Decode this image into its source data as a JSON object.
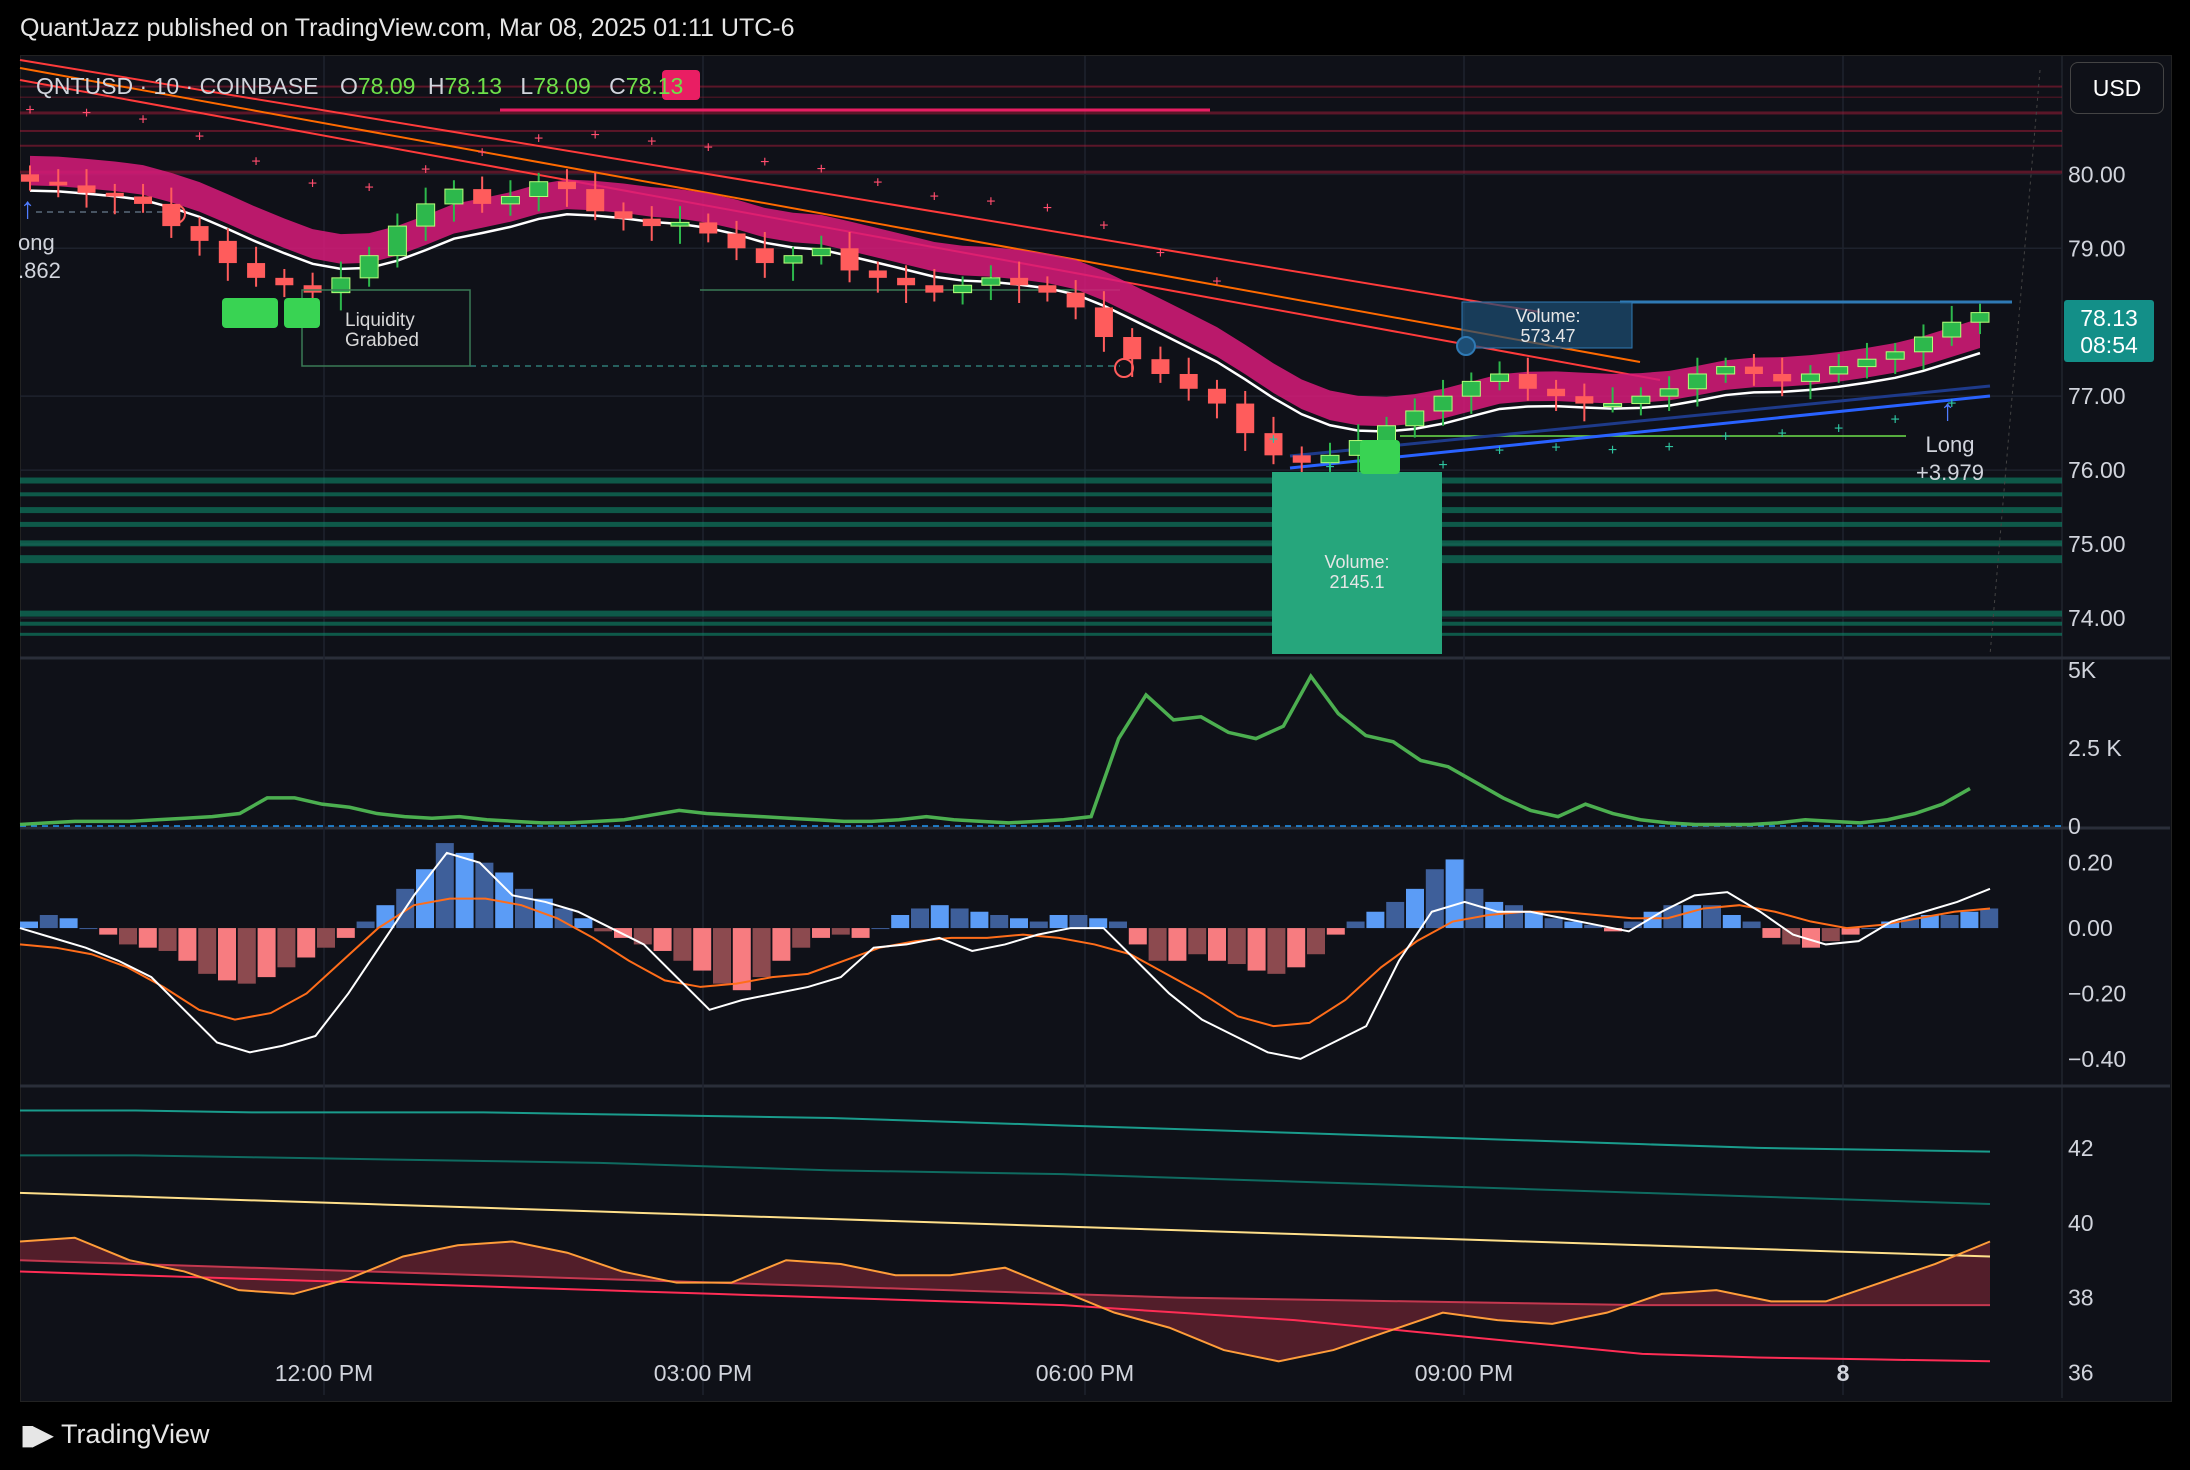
{
  "header": {
    "text": "QuantJazz published on TradingView.com, Mar 08, 2025 01:11 UTC-6"
  },
  "legend": {
    "symbol": "QNTUSD · 10 · COINBASE",
    "open_label": "O",
    "open": "78.09",
    "high_label": "H",
    "high": "78.13",
    "low_label": "L",
    "low": "78.09",
    "close_label": "C",
    "close": "78.13"
  },
  "currency_button": "USD",
  "price_tag": {
    "price": "78.13",
    "countdown": "08:54"
  },
  "annotations": {
    "long_left_label": "ong",
    "long_left_value": ".862",
    "liquidity_line1": "Liquidity",
    "liquidity_line2": "Grabbed",
    "volume_top_title": "Volume:",
    "volume_top_value": "573.47",
    "volume_bottom_title": "Volume:",
    "volume_bottom_value": "2145.1",
    "long_right_label": "Long",
    "long_right_value": "+3.979"
  },
  "footer": {
    "brand": "TradingView"
  },
  "colors": {
    "up": "#2db84c",
    "down": "#ff5c5c",
    "ema_band": "#d81b7a",
    "channel_red": "#ff3b3b",
    "channel_blue": "#2962ff",
    "volume_green": "#26a69a",
    "macd_pos": "#5b9cf6",
    "macd_neg": "#f77c80",
    "rsi_orange": "#ff9800",
    "indicator_green": "#4caf50"
  },
  "chart_data": [
    {
      "type": "candlestick",
      "pane": "price",
      "x_ticks": [
        "12:00 PM",
        "03:00 PM",
        "06:00 PM",
        "09:00 PM",
        "8"
      ],
      "y_ticks": [
        "80.00",
        "79.00",
        "77.00",
        "76.00",
        "75.00",
        "74.00"
      ],
      "ylim": [
        73.5,
        81.6
      ],
      "close_series": [
        79.9,
        79.85,
        79.75,
        79.7,
        79.6,
        79.3,
        79.1,
        78.8,
        78.6,
        78.5,
        78.4,
        78.6,
        78.9,
        79.3,
        79.6,
        79.8,
        79.6,
        79.7,
        79.9,
        79.8,
        79.5,
        79.4,
        79.3,
        79.35,
        79.2,
        79.0,
        78.8,
        78.9,
        79.0,
        78.7,
        78.6,
        78.5,
        78.4,
        78.5,
        78.6,
        78.5,
        78.4,
        78.2,
        77.8,
        77.5,
        77.3,
        77.1,
        76.9,
        76.5,
        76.2,
        76.1,
        76.2,
        76.4,
        76.6,
        76.8,
        77.0,
        77.2,
        77.3,
        77.1,
        77.0,
        76.9,
        76.9,
        77.0,
        77.1,
        77.3,
        77.4,
        77.3,
        77.2,
        77.3,
        77.4,
        77.5,
        77.6,
        77.8,
        78.0,
        78.13
      ]
    },
    {
      "type": "line",
      "pane": "volume_indicator",
      "y_ticks": [
        "5K",
        "2.5 K",
        "0"
      ],
      "ylim": [
        0,
        5000
      ],
      "values": [
        50,
        100,
        150,
        150,
        150,
        200,
        250,
        300,
        400,
        900,
        900,
        700,
        600,
        400,
        300,
        250,
        300,
        200,
        150,
        100,
        100,
        150,
        200,
        350,
        500,
        400,
        350,
        300,
        250,
        200,
        150,
        150,
        200,
        300,
        200,
        150,
        100,
        150,
        200,
        300,
        2800,
        4200,
        3400,
        3500,
        3000,
        2800,
        3200,
        4800,
        3600,
        2900,
        2700,
        2100,
        1900,
        1400,
        900,
        500,
        300,
        700,
        400,
        200,
        100,
        50,
        50,
        50,
        100,
        200,
        150,
        100,
        200,
        400,
        700,
        1200
      ]
    },
    {
      "type": "bar+line",
      "pane": "macd",
      "y_ticks": [
        "0.20",
        "0.00",
        "−0.20",
        "−0.40"
      ],
      "ylim": [
        -0.48,
        0.3
      ],
      "histogram": [
        0.02,
        0.04,
        0.03,
        0.0,
        -0.02,
        -0.05,
        -0.06,
        -0.07,
        -0.1,
        -0.14,
        -0.16,
        -0.17,
        -0.15,
        -0.12,
        -0.09,
        -0.06,
        -0.03,
        0.02,
        0.07,
        0.12,
        0.18,
        0.26,
        0.23,
        0.2,
        0.17,
        0.12,
        0.09,
        0.06,
        0.03,
        -0.01,
        -0.03,
        -0.05,
        -0.07,
        -0.1,
        -0.13,
        -0.17,
        -0.19,
        -0.15,
        -0.1,
        -0.06,
        -0.03,
        -0.02,
        -0.03,
        0.0,
        0.04,
        0.06,
        0.07,
        0.06,
        0.05,
        0.04,
        0.03,
        0.02,
        0.04,
        0.04,
        0.03,
        0.02,
        -0.05,
        -0.1,
        -0.1,
        -0.08,
        -0.1,
        -0.11,
        -0.13,
        -0.14,
        -0.12,
        -0.08,
        -0.02,
        0.02,
        0.05,
        0.08,
        0.12,
        0.18,
        0.21,
        0.12,
        0.08,
        0.07,
        0.05,
        0.03,
        0.02,
        0.01,
        -0.01,
        0.02,
        0.05,
        0.07,
        0.07,
        0.07,
        0.04,
        0.02,
        -0.03,
        -0.05,
        -0.06,
        -0.04,
        -0.02,
        0.0,
        0.02,
        0.03,
        0.04,
        0.04,
        0.05,
        0.06
      ],
      "macd_line": [
        0.0,
        -0.03,
        -0.06,
        -0.1,
        -0.15,
        -0.25,
        -0.35,
        -0.38,
        -0.36,
        -0.33,
        -0.2,
        -0.05,
        0.1,
        0.23,
        0.2,
        0.1,
        0.08,
        0.05,
        0.0,
        -0.05,
        -0.15,
        -0.25,
        -0.22,
        -0.2,
        -0.18,
        -0.15,
        -0.06,
        -0.05,
        -0.03,
        -0.07,
        -0.05,
        -0.02,
        0.0,
        0.0,
        -0.1,
        -0.2,
        -0.28,
        -0.33,
        -0.38,
        -0.4,
        -0.35,
        -0.3,
        -0.1,
        0.05,
        0.08,
        0.05,
        0.05,
        0.03,
        0.01,
        -0.01,
        0.05,
        0.1,
        0.11,
        0.05,
        -0.02,
        -0.05,
        -0.04,
        0.02,
        0.05,
        0.08,
        0.12
      ],
      "signal_line": [
        -0.05,
        -0.06,
        -0.08,
        -0.12,
        -0.18,
        -0.25,
        -0.28,
        -0.26,
        -0.2,
        -0.1,
        0.0,
        0.07,
        0.09,
        0.09,
        0.07,
        0.03,
        -0.03,
        -0.1,
        -0.16,
        -0.18,
        -0.17,
        -0.15,
        -0.14,
        -0.1,
        -0.06,
        -0.04,
        -0.03,
        -0.03,
        -0.02,
        -0.03,
        -0.05,
        -0.08,
        -0.14,
        -0.2,
        -0.27,
        -0.3,
        -0.29,
        -0.22,
        -0.12,
        -0.04,
        0.02,
        0.04,
        0.05,
        0.05,
        0.04,
        0.03,
        0.03,
        0.06,
        0.07,
        0.05,
        0.02,
        0.0,
        0.01,
        0.03,
        0.05,
        0.06
      ]
    },
    {
      "type": "line",
      "pane": "oscillator",
      "y_ticks": [
        "42",
        "40",
        "38",
        "36"
      ],
      "ylim": [
        35.4,
        43.6
      ],
      "series": [
        {
          "values": [
            43.0,
            43.0,
            42.95,
            42.95,
            42.95,
            42.9,
            42.85,
            42.8,
            42.7,
            42.6,
            42.5,
            42.4,
            42.3,
            42.2,
            42.1,
            42.0,
            41.95,
            41.9
          ]
        },
        {
          "values": [
            41.8,
            41.8,
            41.75,
            41.7,
            41.65,
            41.6,
            41.5,
            41.4,
            41.35,
            41.3,
            41.2,
            41.1,
            41.0,
            40.9,
            40.8,
            40.7,
            40.6,
            40.5
          ]
        },
        {
          "values": [
            40.8,
            40.7,
            40.6,
            40.5,
            40.4,
            40.3,
            40.2,
            40.1,
            40.0,
            39.9,
            39.8,
            39.7,
            39.6,
            39.5,
            39.4,
            39.3,
            39.2,
            39.1
          ]
        },
        {
          "values": [
            39.0,
            38.9,
            38.8,
            38.7,
            38.6,
            38.5,
            38.4,
            38.3,
            38.2,
            38.1,
            38.0,
            37.95,
            37.9,
            37.85,
            37.8,
            37.8,
            37.8,
            37.8
          ]
        },
        {
          "values": [
            38.7,
            38.6,
            38.5,
            38.4,
            38.3,
            38.2,
            38.1,
            38.0,
            37.9,
            37.8,
            37.6,
            37.4,
            37.1,
            36.8,
            36.5,
            36.4,
            36.35,
            36.3
          ]
        },
        {
          "values": [
            39.5,
            39.6,
            39.0,
            38.7,
            38.2,
            38.1,
            38.5,
            39.1,
            39.4,
            39.5,
            39.2,
            38.7,
            38.4,
            38.4,
            39.0,
            38.9,
            38.6,
            38.6,
            38.8,
            38.2,
            37.6,
            37.2,
            36.6,
            36.3,
            36.6,
            37.1,
            37.6,
            37.4,
            37.3,
            37.6,
            38.1,
            38.2,
            37.9,
            37.9,
            38.4,
            38.9,
            39.5
          ]
        }
      ]
    }
  ]
}
